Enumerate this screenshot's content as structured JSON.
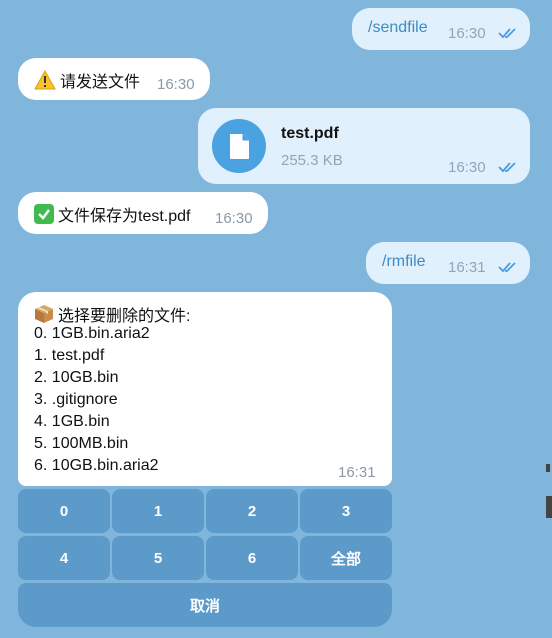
{
  "messages": {
    "m1": {
      "text": "/sendfile",
      "time": "16:30"
    },
    "m2": {
      "text": "请发送文件",
      "time": "16:30",
      "icon": "warning-icon"
    },
    "m3": {
      "file_name": "test.pdf",
      "file_size": "255.3 KB",
      "time": "16:30",
      "icon": "document-icon"
    },
    "m4": {
      "text": "文件保存为test.pdf",
      "time": "16:30",
      "icon": "check-mark-icon"
    },
    "m5": {
      "text": "/rmfile",
      "time": "16:31"
    },
    "m6": {
      "title": "选择要删除的文件:",
      "icon": "package-icon",
      "lines": [
        "0. 1GB.bin.aria2",
        "1. test.pdf",
        "2. 10GB.bin",
        "3. .gitignore",
        "4. 1GB.bin",
        "5. 100MB.bin",
        "6. 10GB.bin.aria2"
      ],
      "time": "16:31"
    }
  },
  "keyboard": {
    "row1": [
      "0",
      "1",
      "2",
      "3"
    ],
    "row2": [
      "4",
      "5",
      "6",
      "全部"
    ],
    "cancel": "取消"
  },
  "colors": {
    "background": "#80b5dc",
    "outgoing": "#e1f0fd",
    "incoming": "#ffffff",
    "button": "#5b9ac9",
    "accent": "#3d8bc6"
  }
}
